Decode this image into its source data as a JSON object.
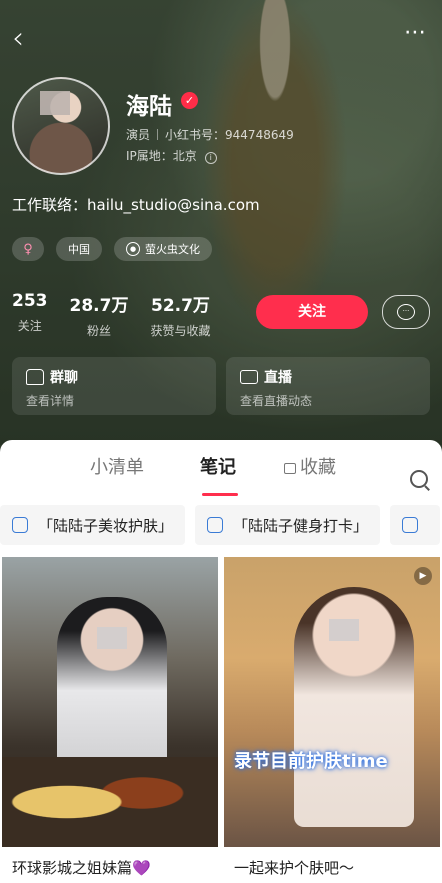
{
  "profile": {
    "name": "海陆",
    "role": "演员",
    "rednote_id_label": "小红书号：",
    "rednote_id": "944748649",
    "ip_label": "IP属地：",
    "ip_location": "北京",
    "contact_label": "工作联络：",
    "contact_email": "hailu_studio@sina.com",
    "tags": [
      "♀",
      "中国",
      "萤火虫文化"
    ]
  },
  "stats": [
    {
      "value": "253",
      "label": "关注"
    },
    {
      "value": "28.7万",
      "label": "粉丝"
    },
    {
      "value": "52.7万",
      "label": "获赞与收藏"
    }
  ],
  "actions": {
    "follow_label": "关注",
    "message_icon": "chat-bubble-icon"
  },
  "cards": [
    {
      "title": "群聊",
      "subtitle": "查看详情"
    },
    {
      "title": "直播",
      "subtitle": "查看直播动态"
    }
  ],
  "tabs": [
    {
      "label": "小清单"
    },
    {
      "label": "笔记"
    },
    {
      "label": "收藏"
    }
  ],
  "collections": [
    "「陆陆子美妆护肤」",
    "「陆陆子健身打卡」"
  ],
  "posts": [
    {
      "caption": "环球影城之姐妹篇💜"
    },
    {
      "caption": "一起来护个肤吧～",
      "overlay_text": "录节目前护肤time"
    }
  ],
  "colors": {
    "accent": "#ff2e4d",
    "panel": "#ffffff"
  }
}
